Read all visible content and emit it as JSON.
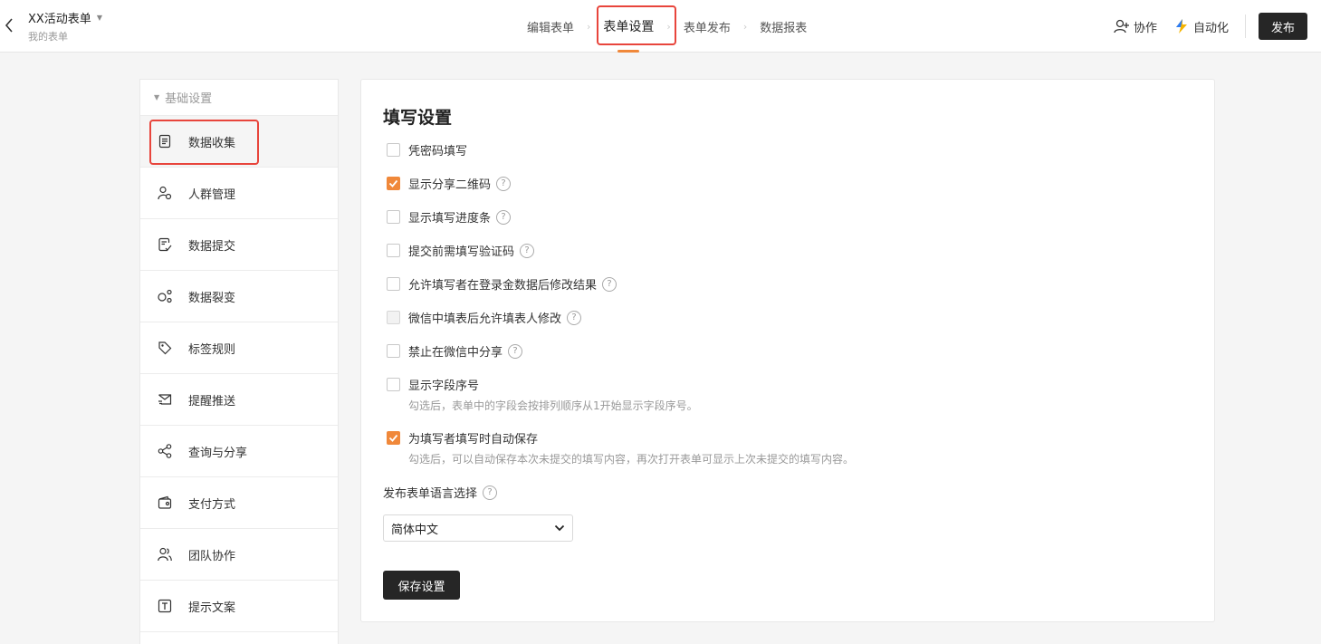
{
  "header": {
    "form_title": "XX活动表单",
    "form_subtitle": "我的表单",
    "steps": [
      "编辑表单",
      "表单设置",
      "表单发布",
      "数据报表"
    ],
    "actions": {
      "collaborate": "协作",
      "automate": "自动化",
      "publish": "发布"
    }
  },
  "sidebar": {
    "group_label": "基础设置",
    "items": [
      {
        "label": "数据收集",
        "icon": "document-icon"
      },
      {
        "label": "人群管理",
        "icon": "user-settings-icon"
      },
      {
        "label": "数据提交",
        "icon": "document-edit-icon"
      },
      {
        "label": "数据裂变",
        "icon": "nodes-icon"
      },
      {
        "label": "标签规则",
        "icon": "tag-icon"
      },
      {
        "label": "提醒推送",
        "icon": "send-message-icon"
      },
      {
        "label": "查询与分享",
        "icon": "share-icon"
      },
      {
        "label": "支付方式",
        "icon": "wallet-icon"
      },
      {
        "label": "团队协作",
        "icon": "team-icon"
      },
      {
        "label": "提示文案",
        "icon": "text-box-icon"
      }
    ]
  },
  "panel": {
    "title": "填写设置",
    "options": [
      {
        "label": "凭密码填写",
        "checked": false
      },
      {
        "label": "显示分享二维码",
        "checked": true
      },
      {
        "label": "显示填写进度条",
        "checked": false
      },
      {
        "label": "提交前需填写验证码",
        "checked": false
      },
      {
        "label": "允许填写者在登录金数据后修改结果",
        "checked": false
      },
      {
        "label": "微信中填表后允许填表人修改",
        "checked": false,
        "disabled": true
      },
      {
        "label": "禁止在微信中分享",
        "checked": false
      },
      {
        "label": "显示字段序号",
        "checked": false,
        "desc": "勾选后，表单中的字段会按排列顺序从1开始显示字段序号。"
      },
      {
        "label": "为填写者填写时自动保存",
        "checked": true,
        "desc": "勾选后，可以自动保存本次未提交的填写内容，再次打开表单可显示上次未提交的填写内容。"
      }
    ],
    "language_label": "发布表单语言选择",
    "language_value": "简体中文",
    "save_label": "保存设置",
    "help_glyph": "?"
  },
  "colors": {
    "accent": "#f0883a",
    "dark_button": "#262626",
    "highlight_box": "#e8453c"
  }
}
